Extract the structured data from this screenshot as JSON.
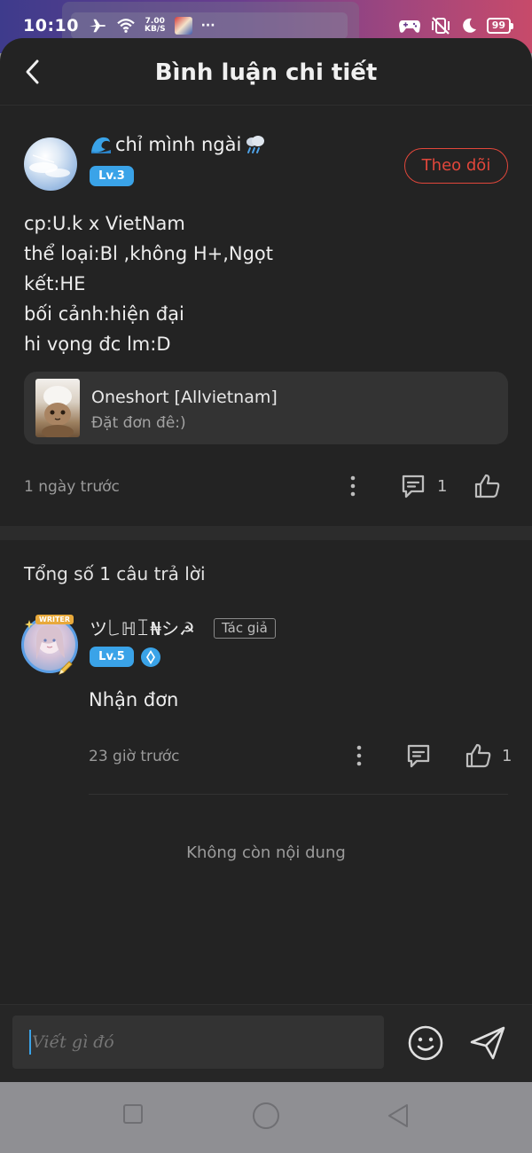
{
  "status_bar": {
    "time": "10:10",
    "speed_value": "7.00",
    "speed_unit": "KB/S",
    "more": "···",
    "battery": "99"
  },
  "header": {
    "title": "Bình luận chi tiết",
    "back_icon": "chevron-left-icon"
  },
  "post": {
    "author_name": "chỉ mình ngài",
    "author_level": "Lv.3",
    "follow_label": "Theo dõi",
    "body_lines": [
      "cp:U.k x VietNam",
      "thể loại:Bl ,không H+,Ngọt",
      "kết:HE",
      "bối cảnh:hiện đại",
      "hi vọng đc lm:D"
    ],
    "linked_story": {
      "title": "Oneshort [Allvietnam]",
      "subtitle": "Đặt đơn đê:)"
    },
    "time_ago": "1 ngày trước",
    "comment_count": "1"
  },
  "replies": {
    "total_label": "Tổng số 1 câu trả lời",
    "items": [
      {
        "name": "ツ꒒ℍꀤ₦シ☭",
        "author_tag": "Tác giả",
        "level": "Lv.5",
        "writer_tag": "WRITER",
        "text": "Nhận đơn",
        "time_ago": "23 giờ trước",
        "like_count": "1"
      }
    ],
    "end_label": "Không còn nội dung"
  },
  "composer": {
    "placeholder": "Viết gì đó"
  },
  "colors": {
    "accent_blue": "#3aa3e8",
    "follow_red": "#e2473b",
    "background": "#232323"
  }
}
